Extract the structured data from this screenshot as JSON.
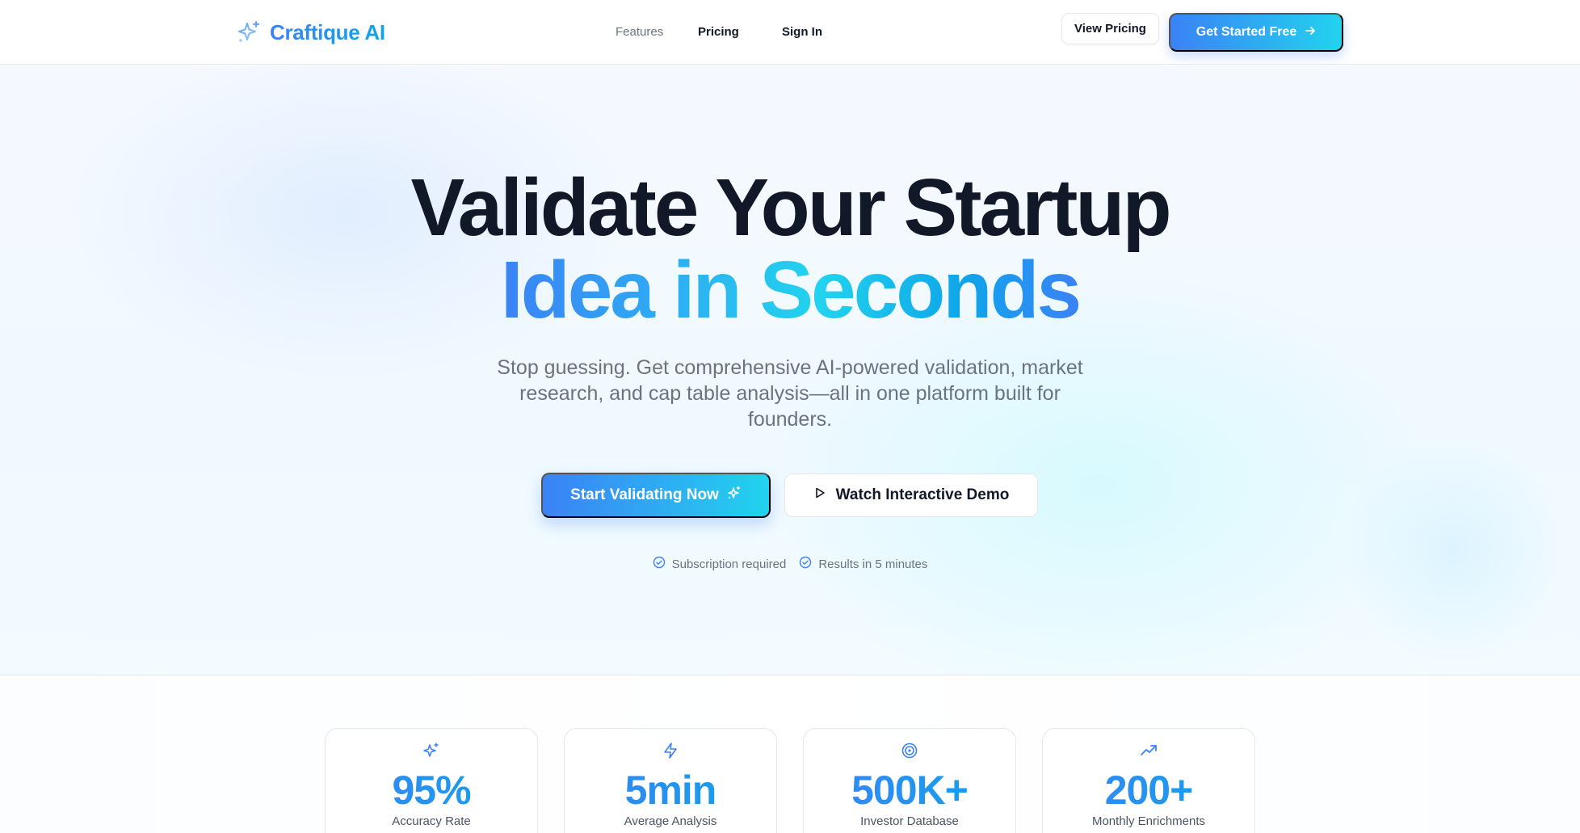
{
  "brand": {
    "name": "Craftique AI",
    "icon": "sparkle-icon"
  },
  "nav": {
    "links": [
      {
        "label": "Features",
        "muted": true
      },
      {
        "label": "Pricing",
        "muted": false
      },
      {
        "label": "Sign In",
        "muted": false
      }
    ],
    "view_pricing": "View Pricing",
    "get_started": "Get Started Free"
  },
  "hero": {
    "headline_line1": "Validate Your Startup",
    "headline_line2": "Idea in Seconds",
    "subtitle": "Stop guessing. Get comprehensive AI-powered validation, market research, and cap table analysis—all in one platform built for founders.",
    "cta_primary": "Start Validating Now",
    "cta_secondary": "Watch Interactive Demo",
    "trust": [
      {
        "label": "Subscription required",
        "icon": "check-circle-icon"
      },
      {
        "label": "Results in 5 minutes",
        "icon": "check-circle-icon"
      }
    ]
  },
  "stats": [
    {
      "value": "95%",
      "label": "Accuracy Rate",
      "icon": "sparkle-icon"
    },
    {
      "value": "5min",
      "label": "Average Analysis",
      "icon": "lightning-icon"
    },
    {
      "value": "500K+",
      "label": "Investor Database",
      "icon": "target-icon"
    },
    {
      "value": "200+",
      "label": "Monthly Enrichments",
      "icon": "trending-up-icon"
    }
  ],
  "colors": {
    "accent_start": "#3b82f6",
    "accent_end": "#22d3ee",
    "text_dark": "#111827",
    "text_muted": "#6b7280"
  }
}
